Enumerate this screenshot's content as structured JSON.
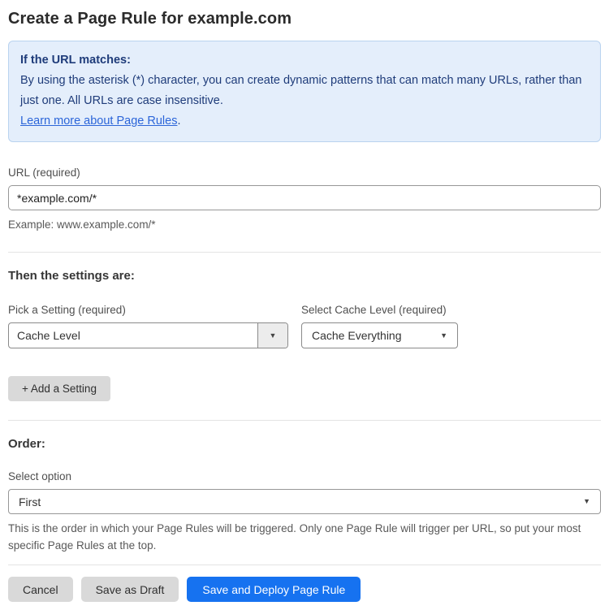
{
  "page": {
    "title": "Create a Page Rule for example.com"
  },
  "info_box": {
    "heading": "If the URL matches:",
    "body": "By using the asterisk (*) character, you can create dynamic patterns that can match many URLs, rather than just one. All URLs are case insensitive.",
    "link_label": "Learn more about Page Rules",
    "link_suffix": "."
  },
  "url_field": {
    "label": "URL (required)",
    "value": "*example.com/*",
    "helper": "Example: www.example.com/*"
  },
  "settings": {
    "heading": "Then the settings are:",
    "pick_setting": {
      "label": "Pick a Setting (required)",
      "value": "Cache Level"
    },
    "cache_level": {
      "label": "Select Cache Level (required)",
      "value": "Cache Everything"
    },
    "add_button_label": "+ Add a Setting"
  },
  "order": {
    "heading": "Order:",
    "label": "Select option",
    "value": "First",
    "helper": "This is the order in which your Page Rules will be triggered. Only one Page Rule will trigger per URL, so put your most specific Page Rules at the top."
  },
  "footer": {
    "cancel_label": "Cancel",
    "save_draft_label": "Save as Draft",
    "save_deploy_label": "Save and Deploy Page Rule"
  },
  "icons": {
    "dropdown_arrow": "▼"
  },
  "colors": {
    "primary_button": "#1672f0",
    "info_background": "#e4eefb",
    "info_border": "#b9d3ef",
    "info_text": "#1f3c7a",
    "link": "#2b65d9",
    "gray_button": "#d9d9d9"
  }
}
